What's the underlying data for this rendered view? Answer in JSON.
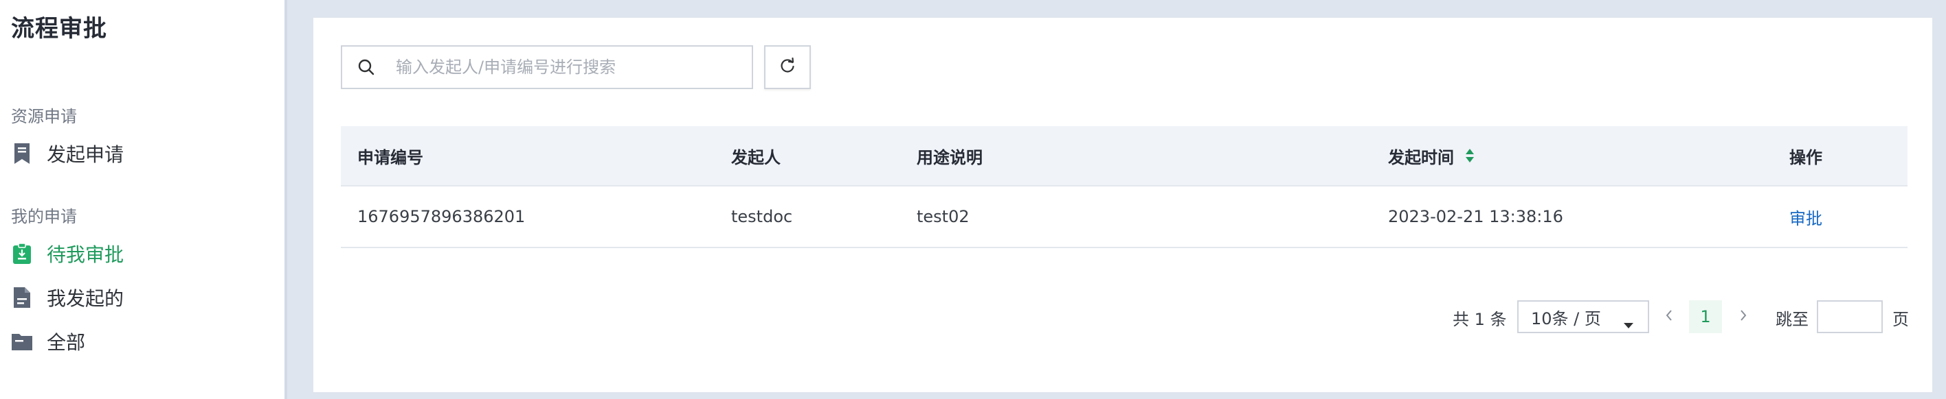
{
  "app": {
    "title": "流程审批"
  },
  "sidebar": {
    "groups": [
      {
        "label": "资源申请",
        "items": [
          {
            "label": "发起申请",
            "icon": "bookmark-icon",
            "active": false
          }
        ]
      },
      {
        "label": "我的申请",
        "items": [
          {
            "label": "待我审批",
            "icon": "pending-doc-icon",
            "active": true
          },
          {
            "label": "我发起的",
            "icon": "document-icon",
            "active": false
          },
          {
            "label": "全部",
            "icon": "folder-icon",
            "active": false
          }
        ]
      }
    ]
  },
  "search": {
    "placeholder": "输入发起人/申请编号进行搜索",
    "value": ""
  },
  "table": {
    "columns": [
      "申请编号",
      "发起人",
      "用途说明",
      "发起时间",
      "操作"
    ],
    "rows": [
      {
        "id": "1676957896386201",
        "initiator": "testdoc",
        "purpose": "test02",
        "time": "2023-02-21 13:38:16",
        "action": "审批"
      }
    ]
  },
  "pagination": {
    "total": "共 1 条",
    "page_size": "10条 / 页",
    "current_page": "1",
    "jump_label": "跳至",
    "jump_value": "",
    "jump_suffix": "页"
  },
  "colors": {
    "accent": "#1f9a5c",
    "link": "#1769c4",
    "background": "#dfe5ee"
  }
}
